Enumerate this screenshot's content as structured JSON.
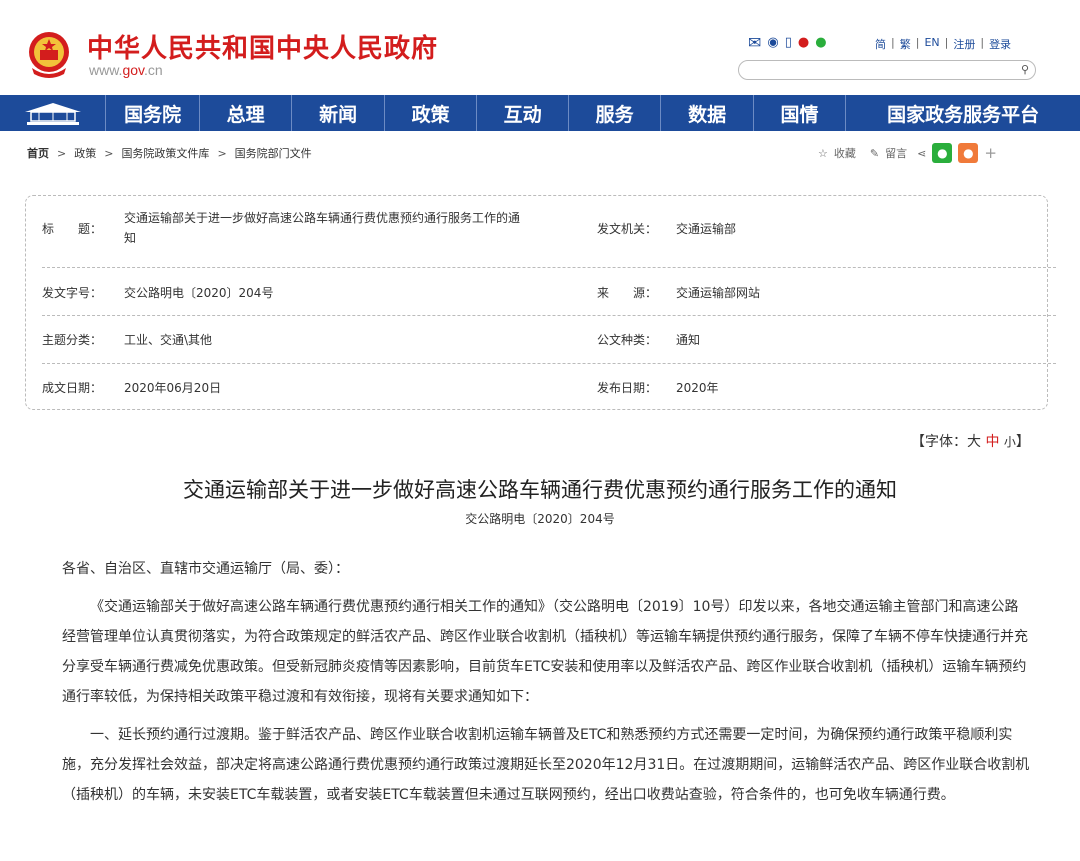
{
  "header": {
    "site_title": "中华人民共和国中央人民政府",
    "url_www": "www.",
    "url_gov": "gov",
    "url_cn": ".cn",
    "lang_jian": "简",
    "lang_fan": "繁",
    "lang_en": "EN",
    "register": "注册",
    "login": "登录"
  },
  "nav": [
    "国务院",
    "总理",
    "新闻",
    "政策",
    "互动",
    "服务",
    "数据",
    "国情",
    "国家政务服务平台"
  ],
  "breadcrumb": [
    "首页",
    "政策",
    "国务院政策文件库",
    "国务院部门文件"
  ],
  "share": {
    "collect": "收藏",
    "comment": "留言"
  },
  "info": {
    "title_label": "标　　题：",
    "title_value_1": "交通运输部关于进一步做好高速公路车辆通行费优惠预约通行服务工作的通",
    "title_value_2": "知",
    "issuer_label": "发文机关：",
    "issuer_value": "交通运输部",
    "docno_label": "发文字号：",
    "docno_value": "交公路明电〔2020〕204号",
    "source_label": "来　　源：",
    "source_value": "交通运输部网站",
    "topic_label": "主题分类：",
    "topic_value": "工业、交通\\其他",
    "type_label": "公文种类：",
    "type_value": "通知",
    "date_label": "成文日期：",
    "date_value": "2020年06月20日",
    "pub_label": "发布日期：",
    "pub_value": "2020年"
  },
  "fontsize": {
    "prefix": "【字体：",
    "big": "大",
    "mid": "中",
    "small": "小",
    "suffix": "】"
  },
  "document": {
    "title": "交通运输部关于进一步做好高速公路车辆通行费优惠预约通行服务工作的通知",
    "number": "交公路明电〔2020〕204号",
    "salutation": "各省、自治区、直辖市交通运输厅（局、委）：",
    "para1": "《交通运输部关于做好高速公路车辆通行费优惠预约通行相关工作的通知》（交公路明电〔2019〕10号）印发以来，各地交通运输主管部门和高速公路经营管理单位认真贯彻落实，为符合政策规定的鲜活农产品、跨区作业联合收割机（插秧机）等运输车辆提供预约通行服务，保障了车辆不停车快捷通行并充分享受车辆通行费减免优惠政策。但受新冠肺炎疫情等因素影响，目前货车ETC安装和使用率以及鲜活农产品、跨区作业联合收割机（插秧机）运输车辆预约通行率较低，为保持相关政策平稳过渡和有效衔接，现将有关要求通知如下：",
    "para2": "一、延长预约通行过渡期。鉴于鲜活农产品、跨区作业联合收割机运输车辆普及ETC和熟悉预约方式还需要一定时间，为确保预约通行政策平稳顺利实施，充分发挥社会效益，部决定将高速公路通行费优惠预约通行政策过渡期延长至2020年12月31日。在过渡期期间，运输鲜活农产品、跨区作业联合收割机（插秧机）的车辆，未安装ETC车载装置，或者安装ETC车载装置但未通过互联网预约，经出口收费站查验，符合条件的，也可免收车辆通行费。"
  }
}
